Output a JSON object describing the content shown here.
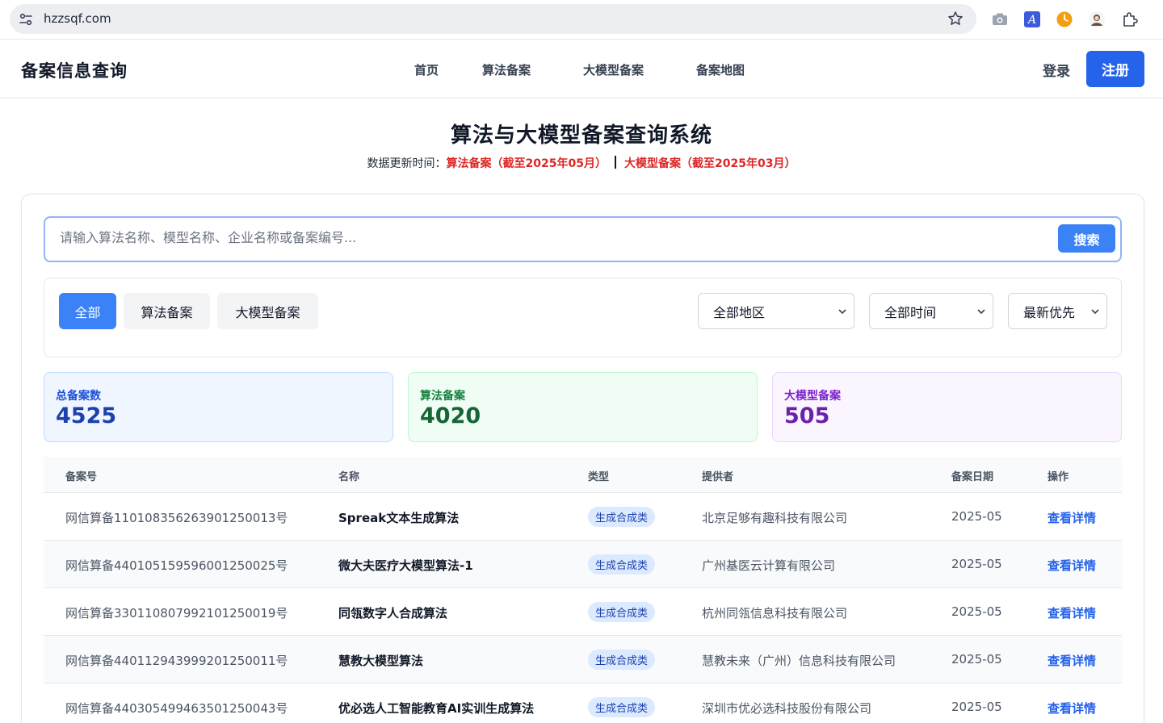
{
  "browser": {
    "url": "hzzsqf.com"
  },
  "header": {
    "brand": "备案信息查询",
    "nav": [
      "首页",
      "算法备案",
      "大模型备案",
      "备案地图"
    ],
    "login": "登录",
    "register": "注册"
  },
  "hero": {
    "title": "算法与大模型备案查询系统",
    "update_prefix": "数据更新时间：",
    "algo_update": "算法备案（截至2025年05月）",
    "model_update": "大模型备案（截至2025年03月）"
  },
  "search": {
    "placeholder": "请输入算法名称、模型名称、企业名称或备案编号...",
    "button": "搜索"
  },
  "filters": {
    "tabs": [
      "全部",
      "算法备案",
      "大模型备案"
    ],
    "region": "全部地区",
    "time": "全部时间",
    "sort": "最新优先"
  },
  "stats": {
    "total_label": "总备案数",
    "total_value": "4525",
    "algo_label": "算法备案",
    "algo_value": "4020",
    "model_label": "大模型备案",
    "model_value": "505"
  },
  "table": {
    "headers": [
      "备案号",
      "名称",
      "类型",
      "提供者",
      "备案日期",
      "操作"
    ],
    "rows": [
      {
        "id": "网信算备110108356263901250013号",
        "name": "Spreak文本生成算法",
        "type": "生成合成类",
        "provider": "北京足够有趣科技有限公司",
        "date": "2025-05",
        "action": "查看详情"
      },
      {
        "id": "网信算备440105159596001250025号",
        "name": "微大夫医疗大模型算法-1",
        "type": "生成合成类",
        "provider": "广州基医云计算有限公司",
        "date": "2025-05",
        "action": "查看详情"
      },
      {
        "id": "网信算备330110807992101250019号",
        "name": "同瓴数字人合成算法",
        "type": "生成合成类",
        "provider": "杭州同瓴信息科技有限公司",
        "date": "2025-05",
        "action": "查看详情"
      },
      {
        "id": "网信算备440112943999201250011号",
        "name": "慧教大模型算法",
        "type": "生成合成类",
        "provider": "慧教未来（广州）信息科技有限公司",
        "date": "2025-05",
        "action": "查看详情"
      },
      {
        "id": "网信算备440305499463501250043号",
        "name": "优必选人工智能教育AI实训生成算法",
        "type": "生成合成类",
        "provider": "深圳市优必选科技股份有限公司",
        "date": "2025-05",
        "action": "查看详情"
      }
    ]
  }
}
